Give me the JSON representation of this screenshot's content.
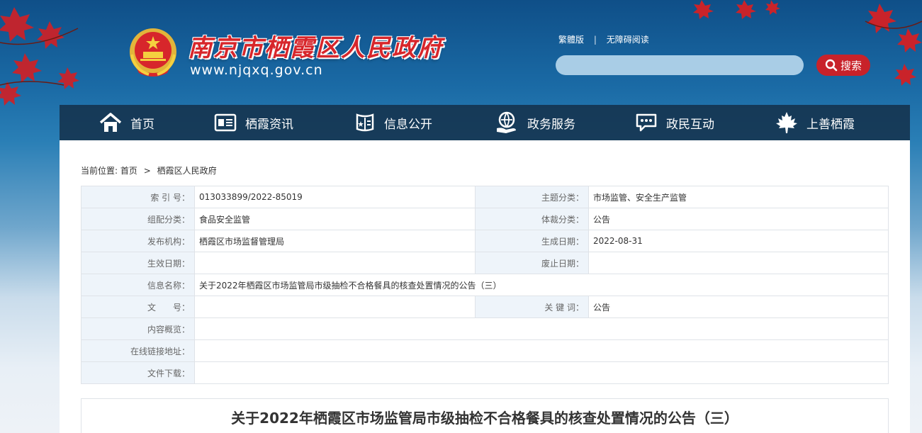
{
  "header": {
    "site_name": "南京市栖霞区人民政府",
    "site_url": "www.njqxq.gov.cn",
    "links": [
      "繁體版",
      "无障碍阅读"
    ],
    "link_separator": "|",
    "search_placeholder": "",
    "search_label": "搜索"
  },
  "nav": [
    {
      "label": "首页",
      "icon": "home-icon"
    },
    {
      "label": "栖霞资讯",
      "icon": "news-icon"
    },
    {
      "label": "信息公开",
      "icon": "document-icon"
    },
    {
      "label": "政务服务",
      "icon": "service-icon"
    },
    {
      "label": "政民互动",
      "icon": "chat-icon"
    },
    {
      "label": "上善栖霞",
      "icon": "maple-leaf-icon"
    }
  ],
  "breadcrumb": {
    "prefix": "当前位置:",
    "items": [
      "首页",
      "栖霞区人民政府"
    ],
    "separator": ">"
  },
  "meta": {
    "index_label": "索 引 号：",
    "index_value": "013033899/2022-85019",
    "topic_label": "主题分类：",
    "topic_value": "市场监管、安全生产监管",
    "org_class_label": "组配分类：",
    "org_class_value": "食品安全监管",
    "genre_label": "体裁分类：",
    "genre_value": "公告",
    "publisher_label": "发布机构：",
    "publisher_value": "栖霞区市场监督管理局",
    "created_label": "生成日期：",
    "created_value": "2022-08-31",
    "effective_label": "生效日期：",
    "effective_value": "",
    "expiry_label": "废止日期：",
    "expiry_value": "",
    "name_label": "信息名称：",
    "name_value": "关于2022年栖霞区市场监管局市级抽检不合格餐具的核查处置情况的公告（三）",
    "docno_label": "文　　号：",
    "docno_value": "",
    "keywords_label": "关 键 词：",
    "keywords_value": "公告",
    "summary_label": "内容概览：",
    "summary_value": "",
    "link_label": "在线链接地址：",
    "link_value": "",
    "download_label": "文件下载：",
    "download_value": ""
  },
  "article": {
    "title": "关于2022年栖霞区市场监管局市级抽检不合格餐具的核查处置情况的公告（三）"
  },
  "colors": {
    "brand_red": "#d7262b",
    "nav_bg": "#142d46",
    "label_bg": "#eef4fa"
  }
}
